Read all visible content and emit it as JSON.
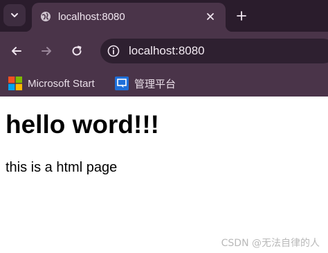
{
  "browser": {
    "tab": {
      "title": "localhost:8080"
    },
    "omnibox": {
      "url": "localhost:8080"
    },
    "bookmarks": [
      {
        "label": "Microsoft Start",
        "icon": "microsoft-logo-icon"
      },
      {
        "label": "管理平台",
        "icon": "admin-platform-icon"
      }
    ],
    "colors": {
      "tabstrip": "#2a1c2c",
      "toolbar": "#4a3449",
      "omnibox": "#2e2030"
    }
  },
  "page": {
    "heading": "hello word!!!",
    "paragraph": "this is a html page"
  },
  "watermark": "CSDN @无法自律的人"
}
